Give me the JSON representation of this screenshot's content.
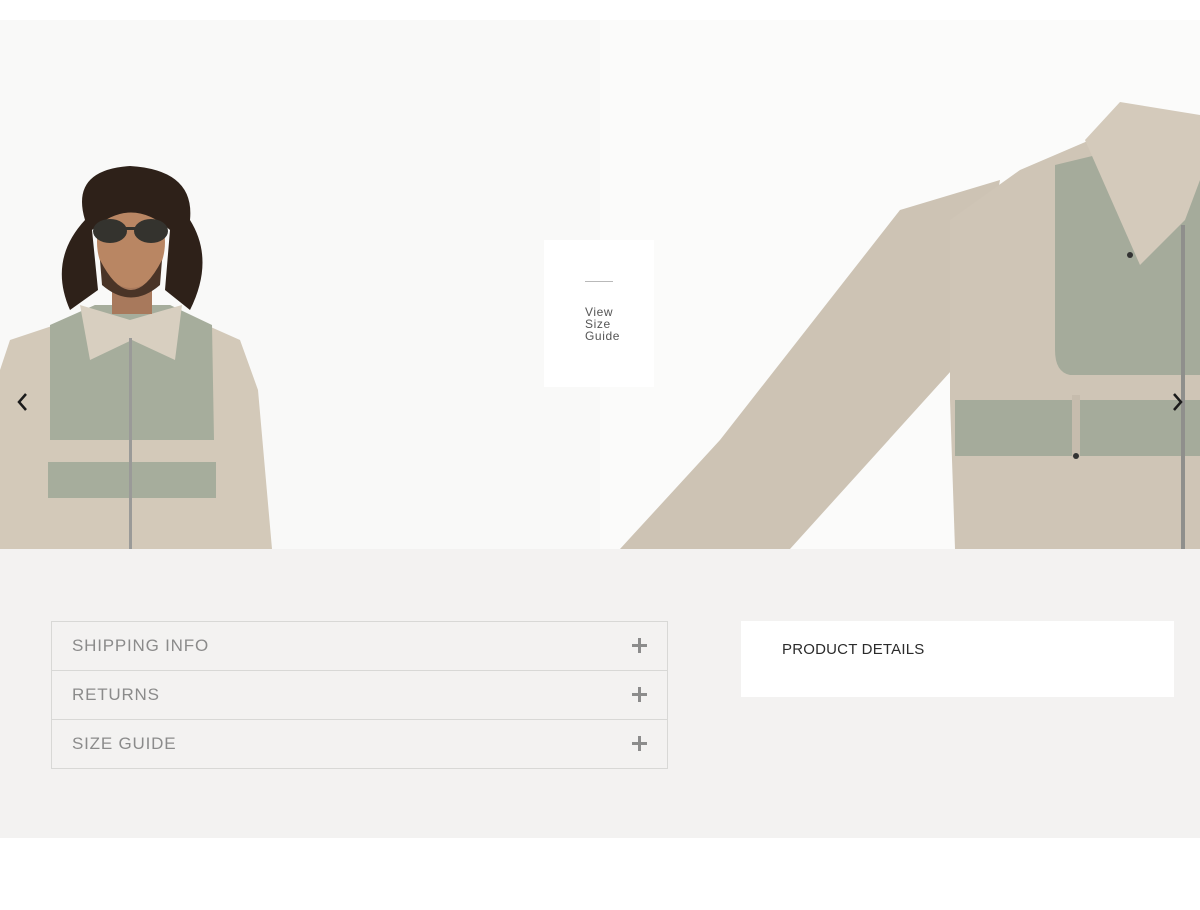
{
  "gallery": {
    "size_guide_link": "View Size Guide",
    "prev_arrow": "chevron-left-icon",
    "next_arrow": "chevron-right-icon"
  },
  "accordion": {
    "items": [
      {
        "label": "SHIPPING INFO",
        "icon": "plus-icon"
      },
      {
        "label": "RETURNS",
        "icon": "plus-icon"
      },
      {
        "label": "SIZE GUIDE",
        "icon": "plus-icon"
      }
    ]
  },
  "product_details": {
    "title": "PRODUCT DETAILS"
  },
  "colors": {
    "band_background": "#f3f2f1",
    "jacket_beige": "#cfc4b4",
    "jacket_sage": "#a3aa99"
  }
}
